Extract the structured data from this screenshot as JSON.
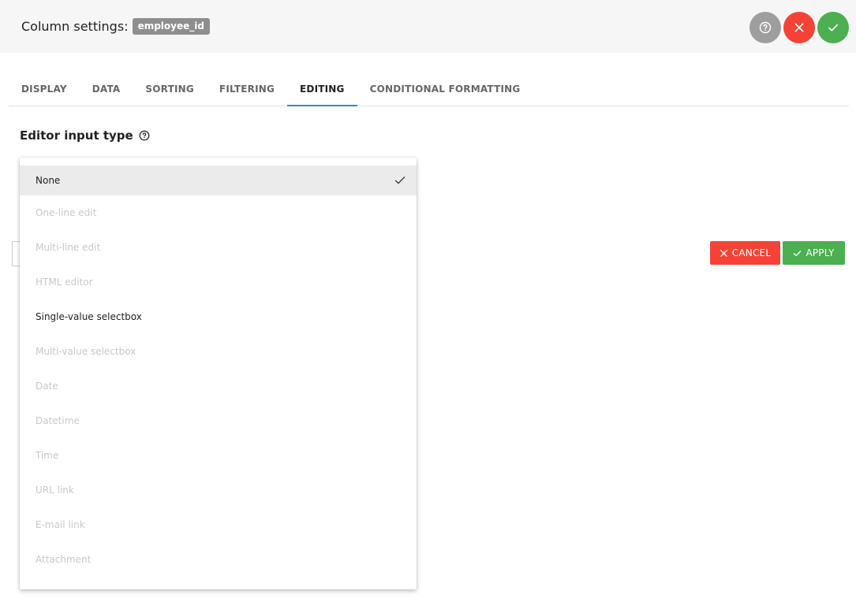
{
  "header": {
    "title": "Column settings:",
    "column_badge": "employee_id",
    "buttons": {
      "help_icon": "help-circle-icon",
      "close_icon": "close-icon",
      "confirm_icon": "check-icon"
    },
    "colors": {
      "help": "#9e9e9e",
      "close": "#f44336",
      "confirm": "#4caf50"
    }
  },
  "tabs": [
    {
      "label": "DISPLAY",
      "active": false
    },
    {
      "label": "DATA",
      "active": false
    },
    {
      "label": "SORTING",
      "active": false
    },
    {
      "label": "FILTERING",
      "active": false
    },
    {
      "label": "EDITING",
      "active": true
    },
    {
      "label": "CONDITIONAL FORMATTING",
      "active": false
    }
  ],
  "editor": {
    "label": "Editor input type",
    "selected": "None",
    "options": [
      {
        "label": "None",
        "enabled": true,
        "selected": true
      },
      {
        "label": "One-line edit",
        "enabled": false
      },
      {
        "label": "Multi-line edit",
        "enabled": false
      },
      {
        "label": "HTML editor",
        "enabled": false
      },
      {
        "label": "Single-value selectbox",
        "enabled": true
      },
      {
        "label": "Multi-value selectbox",
        "enabled": false
      },
      {
        "label": "Date",
        "enabled": false
      },
      {
        "label": "Datetime",
        "enabled": false
      },
      {
        "label": "Time",
        "enabled": false
      },
      {
        "label": "URL link",
        "enabled": false
      },
      {
        "label": "E-mail link",
        "enabled": false
      },
      {
        "label": "Attachment",
        "enabled": false
      }
    ]
  },
  "actions": {
    "cancel_label": "CANCEL",
    "apply_label": "APPLY"
  },
  "accent": "#2d8fc6"
}
